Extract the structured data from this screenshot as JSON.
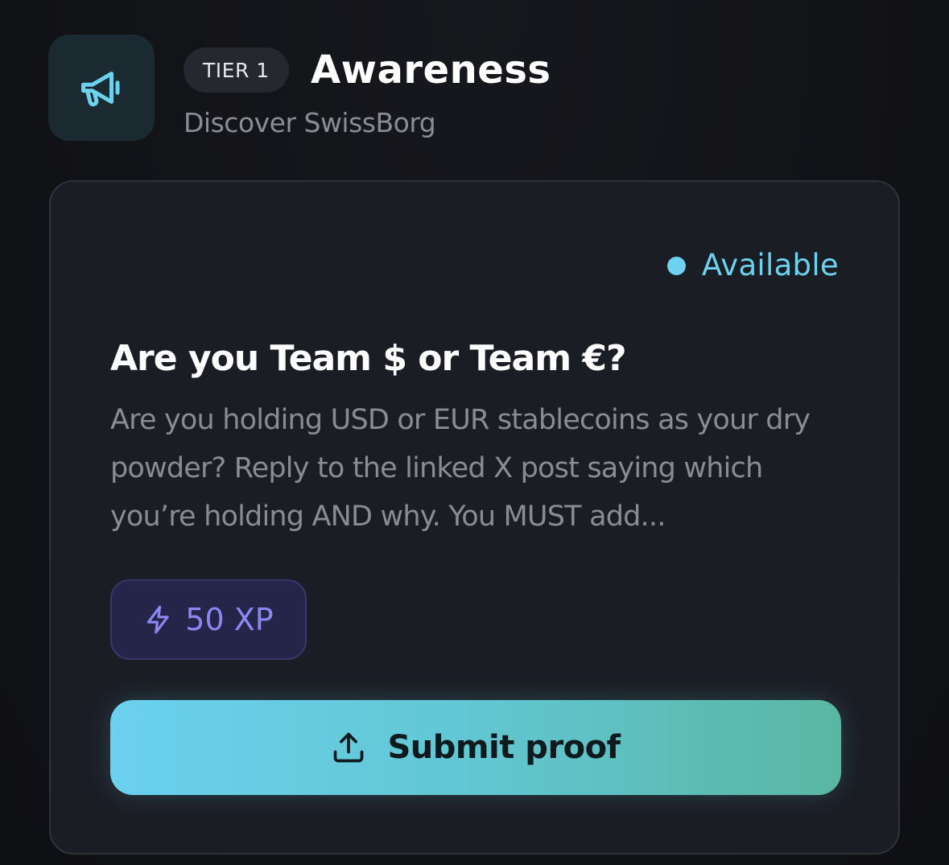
{
  "header": {
    "tier_label": "TIER 1",
    "title": "Awareness",
    "subtitle": "Discover SwissBorg",
    "icon": "megaphone-icon"
  },
  "card": {
    "status": "Available",
    "title": "Are you Team $ or Team €?",
    "description": "Are you holding USD or EUR stablecoins as your dry powder? Reply to the linked X post saying which you’re holding AND why. You MUST add...",
    "reward": {
      "icon": "lightning-icon",
      "label": "50 XP"
    },
    "submit": {
      "icon": "upload-icon",
      "label": "Submit proof"
    }
  },
  "colors": {
    "accent": "#6cd2ee",
    "xp": "#8a87f0",
    "button_start": "#6ad1ee",
    "button_end": "#59b7a3",
    "card_bg": "#1b1d25",
    "page_bg": "#121317"
  }
}
